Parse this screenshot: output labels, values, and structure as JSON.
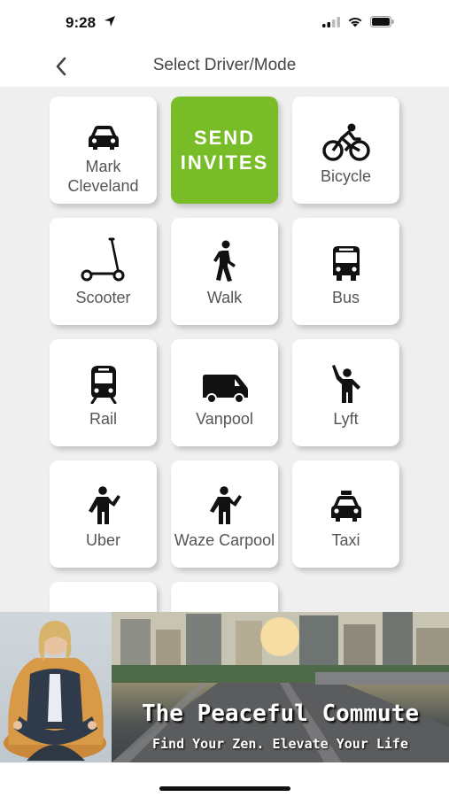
{
  "status_bar": {
    "time": "9:28"
  },
  "nav": {
    "title": "Select Driver/Mode"
  },
  "tiles": [
    {
      "label": "Mark Cleveland",
      "icon": "car-icon"
    },
    {
      "label": "SEND INVITES",
      "icon": ""
    },
    {
      "label": "Bicycle",
      "icon": "bicycle-icon"
    },
    {
      "label": "Scooter",
      "icon": "scooter-icon"
    },
    {
      "label": "Walk",
      "icon": "walk-icon"
    },
    {
      "label": "Bus",
      "icon": "bus-icon"
    },
    {
      "label": "Rail",
      "icon": "rail-icon"
    },
    {
      "label": "Vanpool",
      "icon": "van-icon"
    },
    {
      "label": "Lyft",
      "icon": "hail-icon"
    },
    {
      "label": "Uber",
      "icon": "hail-icon"
    },
    {
      "label": "Waze Carpool",
      "icon": "hail-icon"
    },
    {
      "label": "Taxi",
      "icon": "taxi-icon"
    }
  ],
  "ad": {
    "title": "The Peaceful Commute",
    "subtitle": "Find Your Zen. Elevate Your Life"
  },
  "colors": {
    "accent_green": "#78bc28",
    "tile_background": "#ffffff",
    "page_background": "#efefef"
  }
}
